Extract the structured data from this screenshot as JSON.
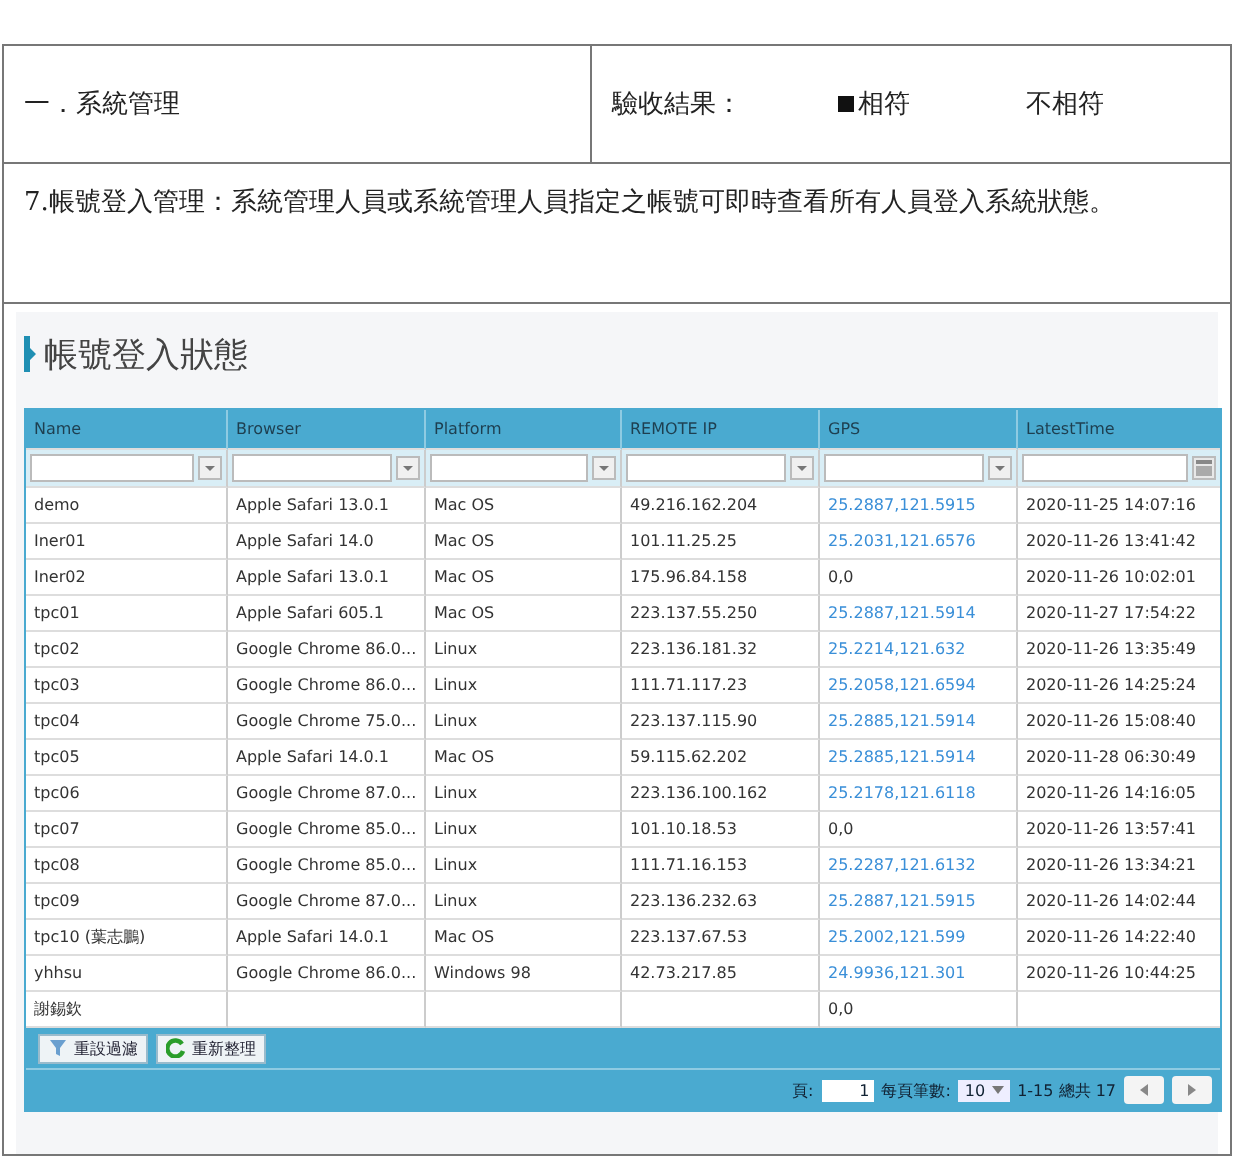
{
  "section": {
    "title": "一．系統管理",
    "result_label": "驗收結果：",
    "options": [
      {
        "label": "相符",
        "selected": true
      },
      {
        "label": "不相符",
        "selected": false
      }
    ]
  },
  "requirement": "7.帳號登入管理：系統管理人員或系統管理人員指定之帳號可即時查看所有人員登入系統狀態。",
  "screen": {
    "title": "帳號登入狀態",
    "columns": [
      {
        "label": "Name",
        "kind": "dropdown"
      },
      {
        "label": "Browser",
        "kind": "dropdown"
      },
      {
        "label": "Platform",
        "kind": "dropdown"
      },
      {
        "label": "REMOTE IP",
        "kind": "dropdown"
      },
      {
        "label": "GPS",
        "kind": "dropdown"
      },
      {
        "label": "LatestTime",
        "kind": "date"
      }
    ],
    "rows": [
      {
        "cells": [
          "demo",
          "Apple Safari 13.0.1",
          "Mac OS",
          "49.216.162.204",
          "25.2887,121.5915",
          "2020-11-25 14:07:16"
        ],
        "gps_link": true
      },
      {
        "cells": [
          "Iner01",
          "Apple Safari 14.0",
          "Mac OS",
          "101.11.25.25",
          "25.2031,121.6576",
          "2020-11-26 13:41:42"
        ],
        "gps_link": true
      },
      {
        "cells": [
          "Iner02",
          "Apple Safari 13.0.1",
          "Mac OS",
          "175.96.84.158",
          "0,0",
          "2020-11-26 10:02:01"
        ],
        "gps_link": false
      },
      {
        "cells": [
          "tpc01",
          "Apple Safari 605.1",
          "Mac OS",
          "223.137.55.250",
          "25.2887,121.5914",
          "2020-11-27 17:54:22"
        ],
        "gps_link": true
      },
      {
        "cells": [
          "tpc02",
          "Google Chrome 86.0...",
          "Linux",
          "223.136.181.32",
          "25.2214,121.632",
          "2020-11-26 13:35:49"
        ],
        "gps_link": true
      },
      {
        "cells": [
          "tpc03",
          "Google Chrome 86.0...",
          "Linux",
          "111.71.117.23",
          "25.2058,121.6594",
          "2020-11-26 14:25:24"
        ],
        "gps_link": true
      },
      {
        "cells": [
          "tpc04",
          "Google Chrome 75.0...",
          "Linux",
          "223.137.115.90",
          "25.2885,121.5914",
          "2020-11-26 15:08:40"
        ],
        "gps_link": true
      },
      {
        "cells": [
          "tpc05",
          "Apple Safari 14.0.1",
          "Mac OS",
          "59.115.62.202",
          "25.2885,121.5914",
          "2020-11-28 06:30:49"
        ],
        "gps_link": true
      },
      {
        "cells": [
          "tpc06",
          "Google Chrome 87.0...",
          "Linux",
          "223.136.100.162",
          "25.2178,121.6118",
          "2020-11-26 14:16:05"
        ],
        "gps_link": true
      },
      {
        "cells": [
          "tpc07",
          "Google Chrome 85.0...",
          "Linux",
          "101.10.18.53",
          "0,0",
          "2020-11-26 13:57:41"
        ],
        "gps_link": false
      },
      {
        "cells": [
          "tpc08",
          "Google Chrome 85.0...",
          "Linux",
          "111.71.16.153",
          "25.2287,121.6132",
          "2020-11-26 13:34:21"
        ],
        "gps_link": true
      },
      {
        "cells": [
          "tpc09",
          "Google Chrome 87.0...",
          "Linux",
          "223.136.232.63",
          "25.2887,121.5915",
          "2020-11-26 14:02:44"
        ],
        "gps_link": true
      },
      {
        "cells": [
          "tpc10 (葉志鵬)",
          "Apple Safari 14.0.1",
          "Mac OS",
          "223.137.67.53",
          "25.2002,121.599",
          "2020-11-26 14:22:40"
        ],
        "gps_link": true
      },
      {
        "cells": [
          "yhhsu",
          "Google Chrome 86.0...",
          "Windows 98",
          "42.73.217.85",
          "24.9936,121.301",
          "2020-11-26 10:44:25"
        ],
        "gps_link": true
      },
      {
        "cells": [
          "謝錫欽",
          "",
          "",
          "",
          "0,0",
          ""
        ],
        "gps_link": false
      }
    ],
    "buttons": [
      {
        "label": "重設過濾",
        "kind": "filter"
      },
      {
        "label": "重新整理",
        "kind": "refresh"
      }
    ],
    "pager": {
      "page_label": "頁:",
      "page": "1",
      "size_label": "每頁筆數:",
      "size": "10",
      "range": "1-15 總共 17"
    }
  }
}
